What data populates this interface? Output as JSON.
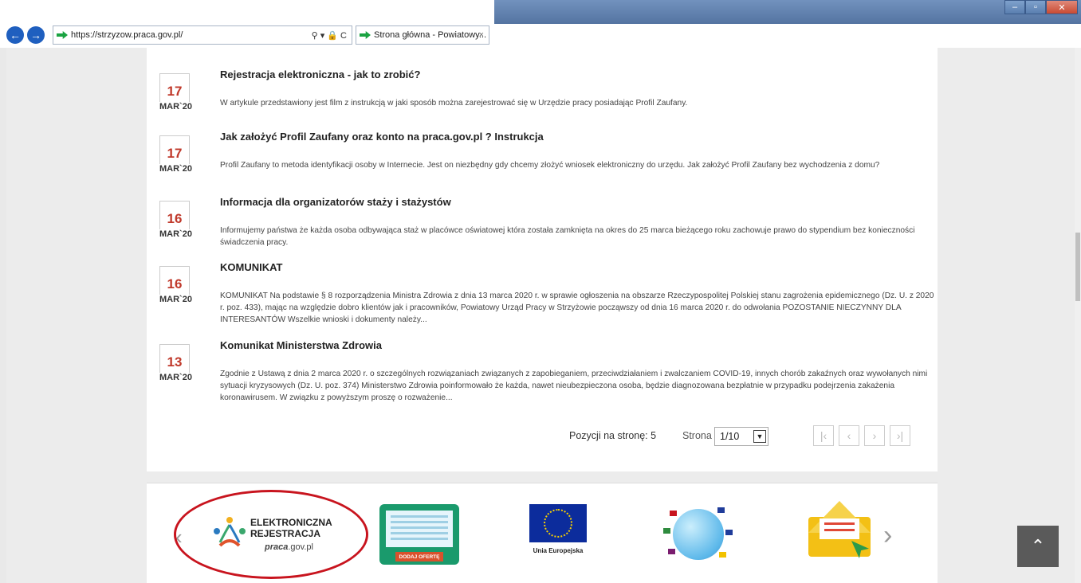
{
  "browser": {
    "url": "https://strzyzow.praca.gov.pl/",
    "tab_title": "Strona główna - Powiatowy...",
    "tab_close": "×",
    "addr_controls": "⚲ ▾ 🔒 C"
  },
  "news": [
    {
      "day": "17",
      "month": "MAR`20",
      "title": "Rejestracja elektroniczna - jak to zrobić?",
      "text": "W artykule przedstawiony jest film z instrukcją w jaki sposób można zarejestrować się w Urzędzie pracy posiadając Profil Zaufany."
    },
    {
      "day": "17",
      "month": "MAR`20",
      "title": "Jak założyć Profil Zaufany oraz konto na praca.gov.pl ? Instrukcja",
      "text": "Profil Zaufany to metoda identyfikacji osoby w Internecie. Jest on niezbędny gdy chcemy złożyć wniosek elektroniczny do urzędu. Jak założyć Profil Zaufany bez wychodzenia z domu?"
    },
    {
      "day": "16",
      "month": "MAR`20",
      "title": "Informacja dla organizatorów staży i stażystów",
      "text": "Informujemy państwa że każda osoba odbywająca staż w placówce oświatowej która została zamknięta na okres do 25 marca bieżącego roku zachowuje prawo do stypendium bez konieczności świadczenia pracy."
    },
    {
      "day": "16",
      "month": "MAR`20",
      "title": "KOMUNIKAT",
      "text": "KOMUNIKAT Na podstawie § 8 rozporządzenia Ministra Zdrowia z dnia 13 marca 2020 r. w sprawie ogłoszenia na obszarze Rzeczypospolitej Polskiej stanu zagrożenia epidemicznego (Dz. U. z 2020 r. poz. 433),  mając na względzie dobro klientów jak i pracowników, Powiatowy Urząd Pracy w Strzyżowie począwszy  od dnia 16 marca 2020 r. do odwołania POZOSTANIE NIECZYNNY DLA INTERESANTÓW   Wszelkie wnioski i dokumenty należy..."
    },
    {
      "day": "13",
      "month": "MAR`20",
      "title": "Komunikat Ministerstwa Zdrowia",
      "text": "Zgodnie z  Ustawą z dnia 2 marca 2020 r. o szczególnych rozwiązaniach związanych z zapobieganiem, przeciwdziałaniem i zwalczaniem COVID-19, innych chorób zakaźnych oraz wywołanych nimi sytuacji kryzysowych (Dz. U. poz. 374) Ministerstwo Zdrowia poinformowało że każda, nawet nieubezpieczona osoba, będzie diagnozowana bezpłatnie w przypadku podejrzenia zakażenia koronawirusem. W związku z powyższym proszę o rozważenie..."
    }
  ],
  "pager": {
    "per_page_label": "Pozycji na stronę: 5",
    "page_label": "Strona",
    "page_value": "1/10",
    "first": "|‹",
    "prev": "‹",
    "next": "›",
    "last": "›|"
  },
  "footer": {
    "er_line1": "ELEKTRONICZNA",
    "er_line2": "REJESTRACJA",
    "er_domain_a": "praca",
    "er_domain_b": ".gov.pl",
    "oferte_button": "DODAJ OFERTĘ",
    "eu_caption": "Unia Europejska"
  },
  "colors": {
    "date_red": "#c0392b",
    "oval_red": "#c8141e"
  }
}
